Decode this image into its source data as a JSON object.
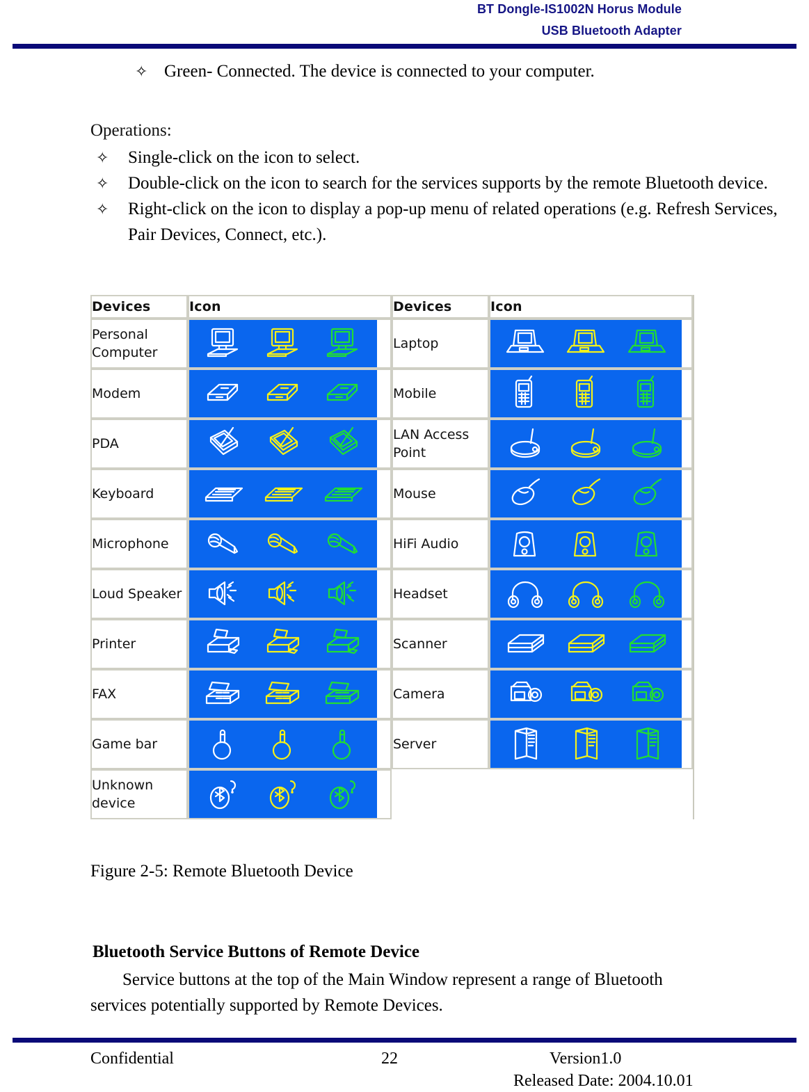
{
  "header": {
    "line1": "BT Dongle-IS1002N Horus Module",
    "line2": "USB Bluetooth Adapter"
  },
  "body": {
    "bullet_glyph": "✧",
    "green_connected": "Green- Connected. The device is connected to your computer.",
    "operations_label": "Operations:",
    "operations": [
      "Single-click on the icon to select.",
      "Double-click on the icon to search for the services supports by the remote Bluetooth device.",
      "Right-click on the icon to display a pop-up menu of related operations (e.g. Refresh Services, Pair Devices, Connect, etc.)."
    ],
    "figure_caption": "Figure 2-5: Remote Bluetooth Device",
    "section_heading": "Bluetooth Service Buttons of Remote Device",
    "section_paragraph_line1": "Service buttons at the top of the Main Window represent a range of Bluetooth",
    "section_paragraph_line2": "services potentially supported by Remote Devices."
  },
  "device_table": {
    "headers": {
      "devices": "Devices",
      "icon": "Icon"
    },
    "icon_band_color": "#0a66ee",
    "icon_state_colors": [
      "#ffffff",
      "#f2f21a",
      "#22dd33"
    ],
    "rows": [
      {
        "left_device": "Personal Computer",
        "left_icon": "desktop-computer-icon",
        "right_device": "Laptop",
        "right_icon": "laptop-icon"
      },
      {
        "left_device": "Modem",
        "left_icon": "modem-icon",
        "right_device": "Mobile",
        "right_icon": "mobile-phone-icon"
      },
      {
        "left_device": "PDA",
        "left_icon": "pda-icon",
        "right_device": "LAN Access Point",
        "right_icon": "lan-access-point-icon"
      },
      {
        "left_device": "Keyboard",
        "left_icon": "keyboard-icon",
        "right_device": "Mouse",
        "right_icon": "mouse-icon"
      },
      {
        "left_device": "Microphone",
        "left_icon": "microphone-icon",
        "right_device": "HiFi Audio",
        "right_icon": "hifi-audio-icon"
      },
      {
        "left_device": "Loud Speaker",
        "left_icon": "loud-speaker-icon",
        "right_device": "Headset",
        "right_icon": "headset-icon"
      },
      {
        "left_device": "Printer",
        "left_icon": "printer-icon",
        "right_device": "Scanner",
        "right_icon": "scanner-icon"
      },
      {
        "left_device": "FAX",
        "left_icon": "fax-icon",
        "right_device": "Camera",
        "right_icon": "camera-icon"
      },
      {
        "left_device": "Game bar",
        "left_icon": "game-bar-icon",
        "right_device": "Server",
        "right_icon": "server-icon"
      },
      {
        "left_device": "Unknown device",
        "left_icon": "unknown-device-icon",
        "right_device": "",
        "right_icon": ""
      }
    ]
  },
  "footer": {
    "confidential": "Confidential",
    "page_number": "22",
    "version": "Version1.0",
    "released_date": "Released Date: 2004.10.01"
  }
}
